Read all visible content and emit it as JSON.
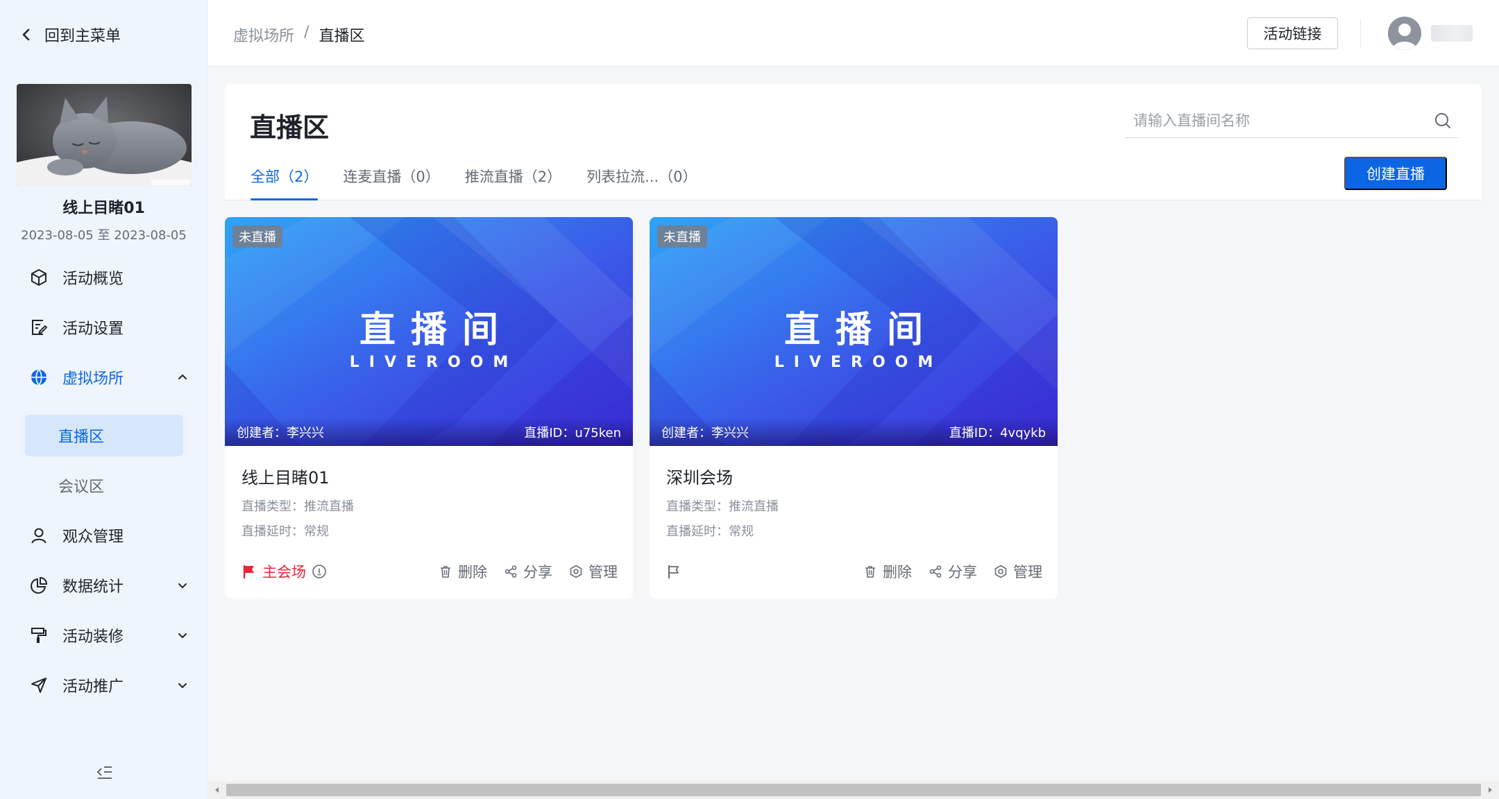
{
  "sidebar": {
    "back_label": "回到主菜单",
    "event": {
      "name": "线上目睹01",
      "date_range": "2023-08-05 至 2023-08-05"
    },
    "nav": [
      {
        "label": "活动概览",
        "icon": "cube-icon"
      },
      {
        "label": "活动设置",
        "icon": "edit-note-icon"
      },
      {
        "label": "虚拟场所",
        "icon": "globe-icon",
        "expanded": true
      },
      {
        "label": "观众管理",
        "icon": "user-icon"
      },
      {
        "label": "数据统计",
        "icon": "pie-chart-icon"
      },
      {
        "label": "活动装修",
        "icon": "paint-roller-icon"
      },
      {
        "label": "活动推广",
        "icon": "send-icon"
      }
    ],
    "sub_items": [
      {
        "label": "直播区",
        "selected": true
      },
      {
        "label": "会议区",
        "selected": false
      }
    ]
  },
  "header": {
    "breadcrumb": {
      "parent": "虚拟场所",
      "separator": "/",
      "current": "直播区"
    },
    "link_button": "活动链接"
  },
  "main": {
    "title": "直播区",
    "search": {
      "placeholder": "请输入直播间名称",
      "value": ""
    },
    "tabs": [
      {
        "label": "全部（2）",
        "active": true
      },
      {
        "label": "连麦直播（0）",
        "active": false
      },
      {
        "label": "推流直播（2）",
        "active": false
      },
      {
        "label": "列表拉流...（0）",
        "active": false
      }
    ],
    "create_button": "创建直播",
    "cover": {
      "title": "直播间",
      "subtitle": "LIVEROOM"
    },
    "cards": [
      {
        "status": "未直播",
        "creator": "创建者：李兴兴",
        "live_id": "直播ID：u75ken",
        "name": "线上目睹01",
        "type": "直播类型：推流直播",
        "latency": "直播延时：常规",
        "main_venue": "主会场",
        "is_main": true
      },
      {
        "status": "未直播",
        "creator": "创建者：李兴兴",
        "live_id": "直播ID：4vqykb",
        "name": "深圳会场",
        "type": "直播类型：推流直播",
        "latency": "直播延时：常规",
        "is_main": false
      }
    ],
    "actions": {
      "delete": "删除",
      "share": "分享",
      "manage": "管理"
    }
  },
  "colors": {
    "primary": "#0c66e4",
    "danger": "#e8253a",
    "sidebar_bg": "#eff5fc"
  }
}
